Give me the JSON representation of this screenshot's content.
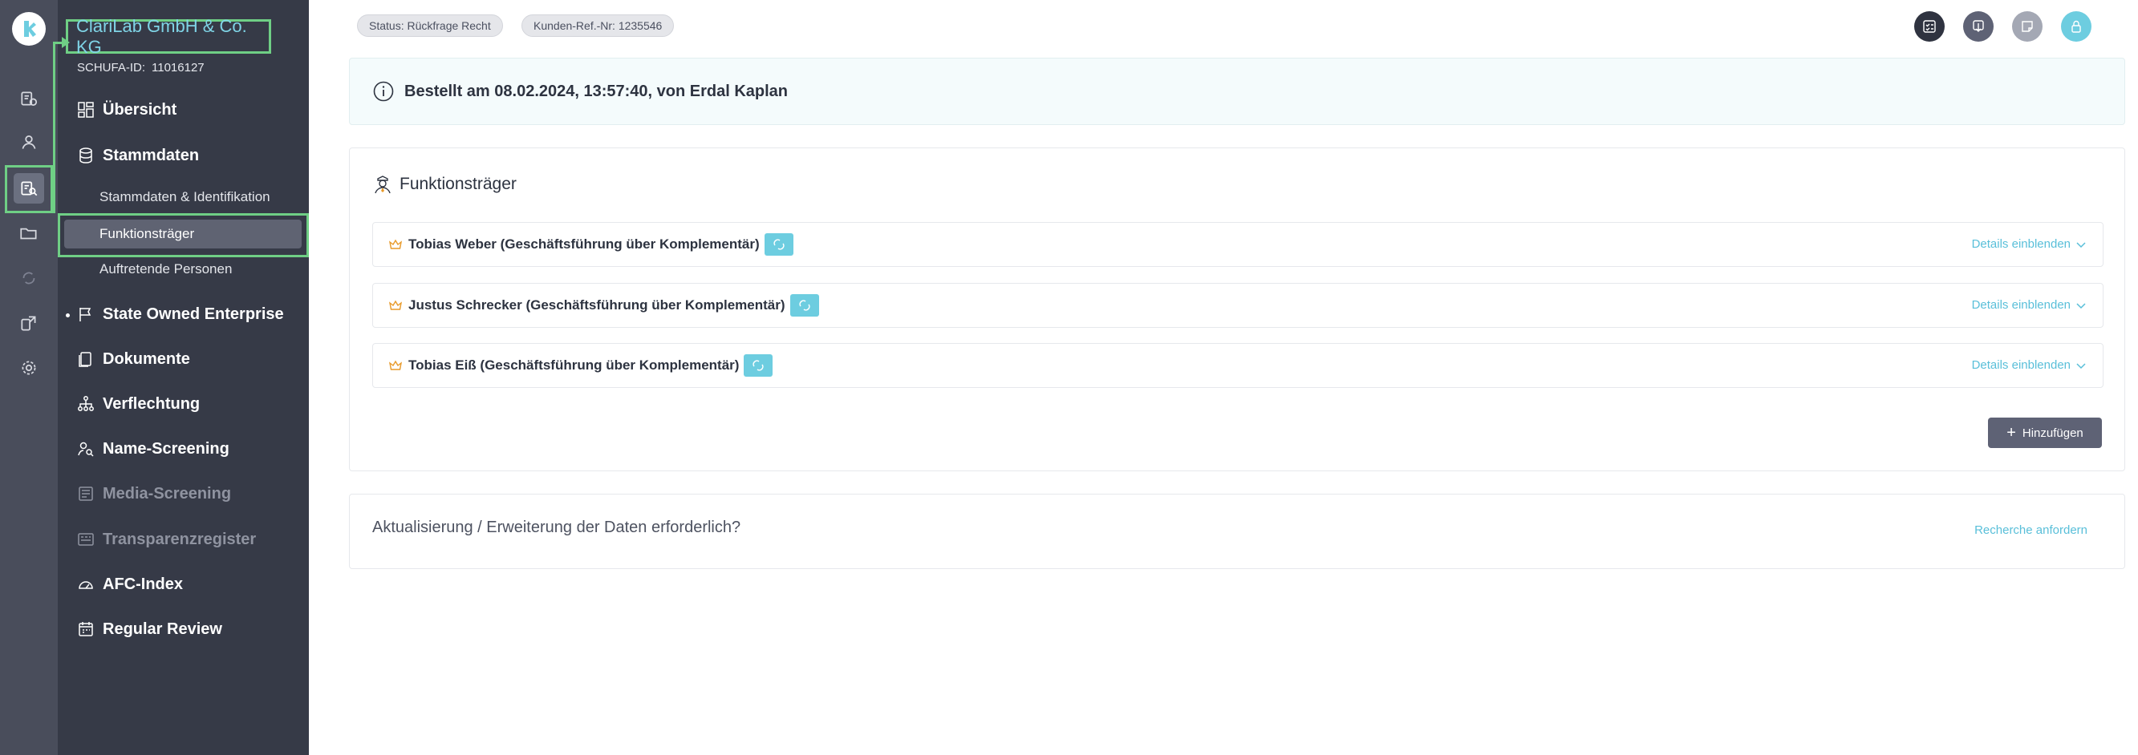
{
  "company": {
    "name": "ClariLab GmbH & Co. KG",
    "schufa_label": "SCHUFA-ID:",
    "schufa_id": "11016127"
  },
  "rail": {
    "items": [
      "documents-check-icon",
      "user-icon",
      "search-document-icon",
      "folder-icon",
      "refresh-icon",
      "transfer-icon",
      "gear-icon"
    ],
    "active_index": 2
  },
  "nav": {
    "uebersicht": "Übersicht",
    "stammdaten": "Stammdaten",
    "sub": {
      "identifikation": "Stammdaten & Identifikation",
      "funktionstraeger": "Funktionsträger",
      "personen": "Auftretende Personen"
    },
    "soe": "State Owned Enterprise",
    "dokumente": "Dokumente",
    "verflechtung": "Verflechtung",
    "name_screening": "Name-Screening",
    "media_screening": "Media-Screening",
    "transparenzregister": "Transparenzregister",
    "afc_index": "AFC-Index",
    "regular_review": "Regular Review"
  },
  "header": {
    "status_chip": "Status: Rückfrage Recht",
    "ref_chip": "Kunden-Ref.-Nr: 1235546"
  },
  "banner": {
    "text": "Bestellt am 08.02.2024, 13:57:40, von Erdal Kaplan"
  },
  "section": {
    "title": "Funktionsträger",
    "persons": [
      {
        "name": "Tobias Weber (Geschäftsführung über Komplementär)"
      },
      {
        "name": "Justus Schrecker (Geschäftsführung über Komplementär)"
      },
      {
        "name": "Tobias Eiß (Geschäftsführung über Komplementär)"
      }
    ],
    "details_label": "Details einblenden",
    "add_label": "Hinzufügen"
  },
  "update": {
    "question": "Aktualisierung / Erweiterung der Daten erforderlich?",
    "link": "Recherche anfordern"
  },
  "colors": {
    "accent": "#59bfd9",
    "highlight": "#6fcf85",
    "sidebar": "#363a47",
    "rail": "#494d5b"
  }
}
